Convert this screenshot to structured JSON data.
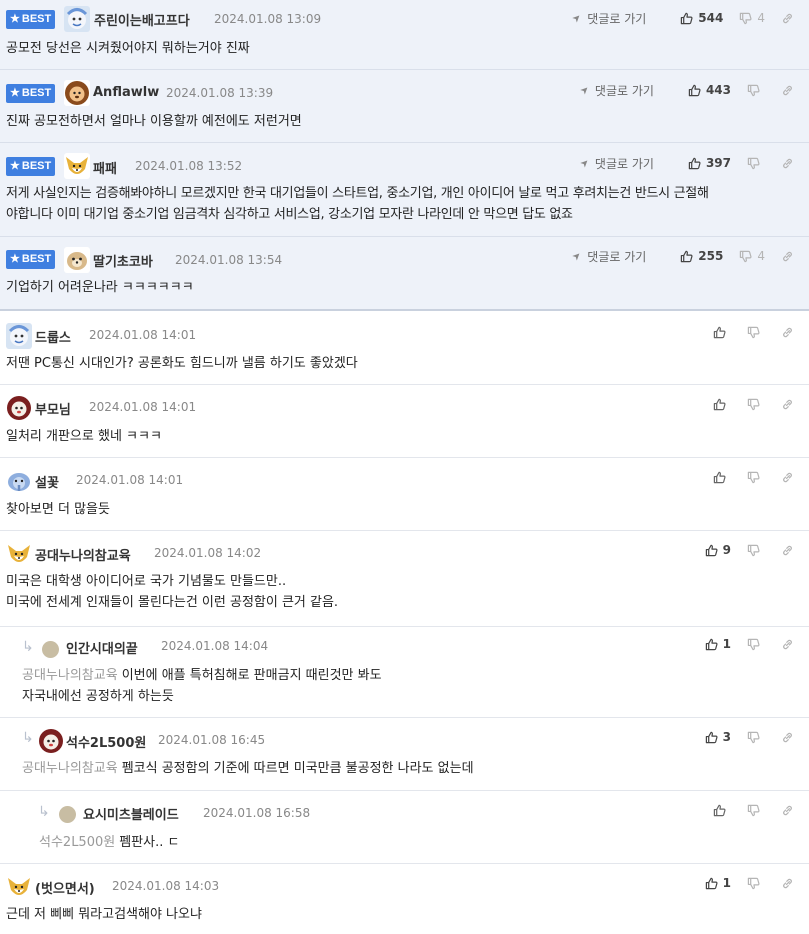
{
  "best_label": "BEST",
  "reply_label": "댓글로 가기",
  "comments": [
    {
      "nick": "주린이는배고프다",
      "date": "2024.01.08 13:09",
      "text": "공모전 당선은 시켜줬어야지 뭐하는거야 진짜",
      "up": "544",
      "down": "4",
      "avatar": "baby-face-blue"
    },
    {
      "nick": "Anflawlw",
      "date": "2024.01.08 13:39",
      "text": "진짜 공모전하면서 얼마나 이용할까 예전에도 저런거면",
      "up": "443",
      "down": "",
      "avatar": "lion-brown"
    },
    {
      "nick": "패패",
      "date": "2024.01.08 13:52",
      "text_line1": "저게 사실인지는 검증해봐야하니 모르겠지만 한국 대기업들이 스타트업, 중소기업, 개인 아이디어 날로 먹고 후려치는건 반드시 근절해",
      "text_line2": "야합니다 이미 대기업 중소기업 임금격차 심각하고 서비스업, 강소기업 모자란 나라인데 안 막으면 답도 없죠",
      "up": "397",
      "down": "",
      "avatar": "fox-yellow"
    },
    {
      "nick": "딸기초코바",
      "date": "2024.01.08 13:54",
      "text": "기업하기 어려운나라 ㅋㅋㅋㅋㅋㅋ",
      "up": "255",
      "down": "4",
      "avatar": "puppy-tan"
    },
    {
      "nick": "드룹스",
      "date": "2024.01.08 14:01",
      "text": "저땐 PC통신 시대인가? 공론화도 힘드니까 낼름 하기도 좋았겠다",
      "up": "",
      "down": "",
      "avatar": "baby-face-blue"
    },
    {
      "nick": "부모님",
      "date": "2024.01.08 14:01",
      "text": "일처리 개판으로 했네 ㅋㅋㅋ",
      "up": "",
      "down": "",
      "avatar": "dog-red"
    },
    {
      "nick": "설꽃",
      "date": "2024.01.08 14:01",
      "text": "찾아보면 더 많을듯",
      "up": "",
      "down": "",
      "avatar": "elephant-blue"
    },
    {
      "nick": "공대누나의참교육",
      "date": "2024.01.08 14:02",
      "text_line1": "미국은 대학생 아이디어로 국가 기념물도 만들드만..",
      "text_line2": "미국에 전세계 인재들이 몰린다는건 이런 공정함이 큰거 같음.",
      "up": "9",
      "down": "",
      "avatar": "fox-yellow"
    },
    {
      "nick": "인간시대의끝",
      "date": "2024.01.08 14:04",
      "tag": "공대누나의참교육",
      "text_line1": "이번에 애플 특허침해로 판매금지 때린것만 봐도",
      "text_line2": "자국내에선 공정하게 하는듯",
      "up": "1",
      "down": "",
      "avatar": "dot"
    },
    {
      "nick": "석수2L500원",
      "date": "2024.01.08 16:45",
      "tag": "공대누나의참교육",
      "text": "펨코식 공정함의 기준에 따르면 미국만큼 불공정한 나라도 없는데",
      "up": "3",
      "down": "",
      "avatar": "dog-red"
    },
    {
      "nick": "요시미츠블레이드",
      "date": "2024.01.08 16:58",
      "tag": "석수2L500원",
      "text": "펨판사.. ㄷ",
      "up": "",
      "down": "",
      "avatar": "dot"
    },
    {
      "nick": "(벗으면서)",
      "date": "2024.01.08 14:03",
      "text": "근데 저 삐삐 뭐라고검색해야 나오냐",
      "up": "1",
      "down": "",
      "avatar": "fox-yellow"
    }
  ]
}
